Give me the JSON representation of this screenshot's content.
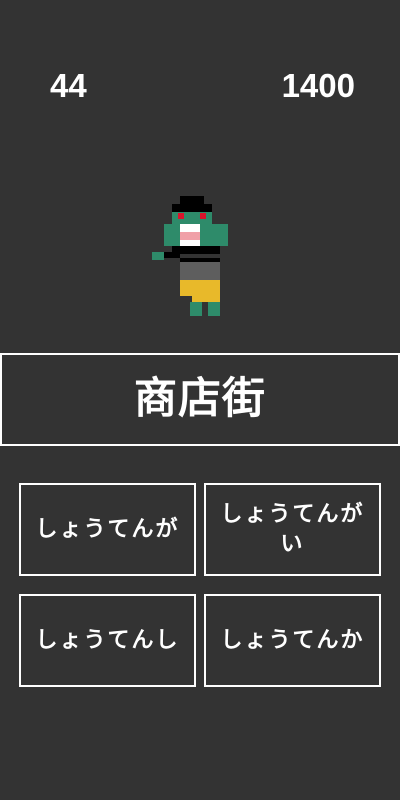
{
  "hud": {
    "left_value": "44",
    "right_value": "1400"
  },
  "character": {
    "icon": "zombie-sprite",
    "colors": {
      "skin": "#2e8b6a",
      "hair": "#000000",
      "eyes": "#d9142b",
      "mouth": "#ffffff",
      "tongue": "#f0a0a8",
      "pants": "#5e5e5e",
      "rag": "#e8b92a",
      "feet": "#2e8b6a"
    }
  },
  "word": {
    "kanji": "商店街"
  },
  "choices": [
    {
      "label": "しょうてんが"
    },
    {
      "label": "しょうてんがい"
    },
    {
      "label": "しょうてんし"
    },
    {
      "label": "しょうてんか"
    }
  ],
  "colors": {
    "background": "#333333",
    "border": "#ffffff",
    "text": "#ffffff"
  }
}
